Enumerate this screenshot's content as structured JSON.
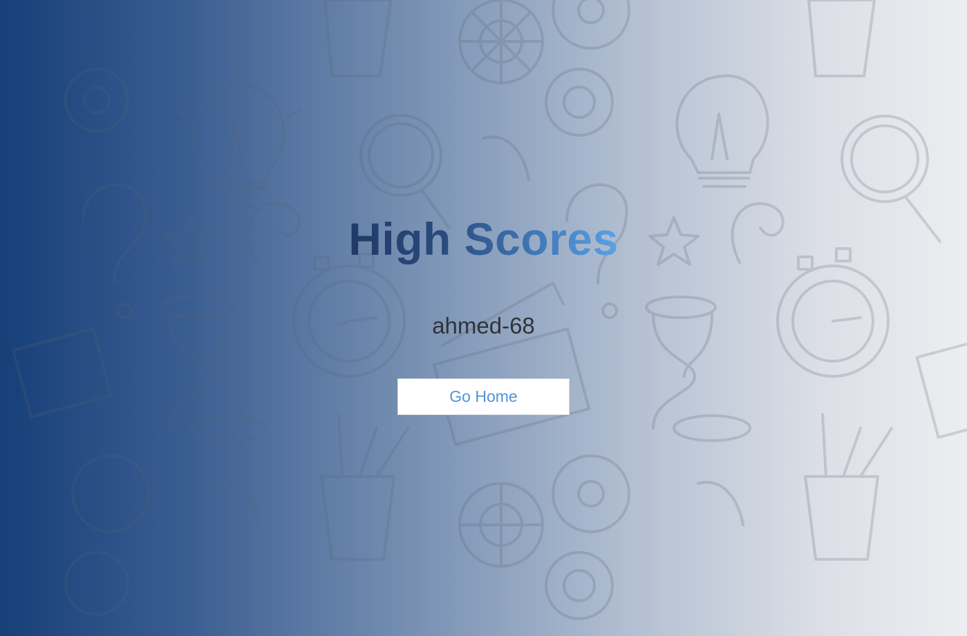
{
  "page": {
    "title": "High Scores",
    "player_entry": "ahmed-68",
    "home_button_label": "Go Home"
  },
  "colors": {
    "background_left": "#173f78",
    "background_right": "#eceef1",
    "title_start": "#1f3a66",
    "title_end": "#5aa2e6",
    "button_text": "#4e95d6",
    "button_bg": "#ffffff"
  },
  "background_icons": [
    "lightbulb-icon",
    "gear-icon",
    "magnifier-icon",
    "stopwatch-icon",
    "hourglass-icon",
    "clapperboard-icon",
    "pencil-cup-icon",
    "star-icon",
    "question-mark-icon"
  ]
}
